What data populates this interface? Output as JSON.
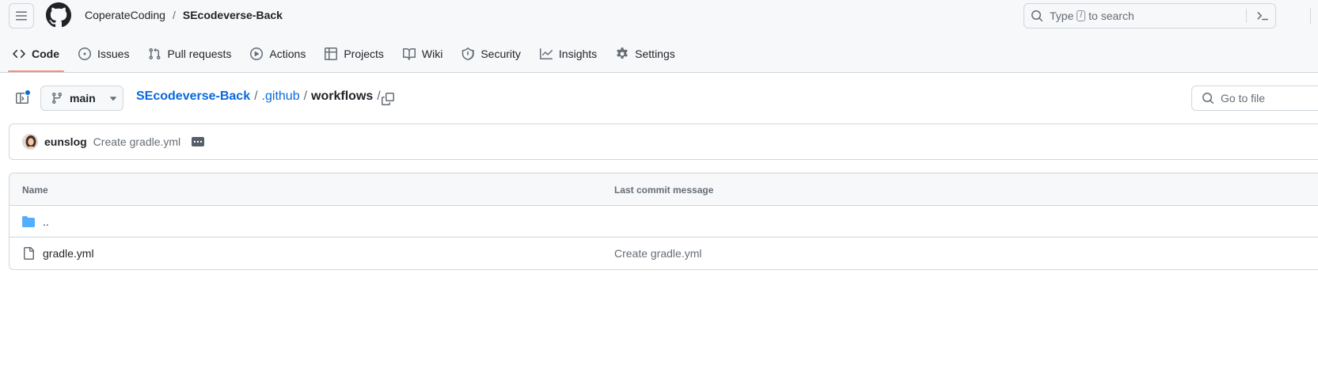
{
  "header": {
    "owner": "CoperateCoding",
    "separator": "/",
    "repo": "SEcodeverse-Back",
    "search": {
      "prefix": "Type",
      "shortcut": "/",
      "suffix": "to search"
    }
  },
  "nav": {
    "tabs": [
      {
        "label": "Code",
        "icon": "code-icon",
        "selected": true
      },
      {
        "label": "Issues",
        "icon": "issue-opened-icon"
      },
      {
        "label": "Pull requests",
        "icon": "git-pull-request-icon"
      },
      {
        "label": "Actions",
        "icon": "play-icon"
      },
      {
        "label": "Projects",
        "icon": "table-icon"
      },
      {
        "label": "Wiki",
        "icon": "book-icon"
      },
      {
        "label": "Security",
        "icon": "shield-icon"
      },
      {
        "label": "Insights",
        "icon": "graph-icon"
      },
      {
        "label": "Settings",
        "icon": "gear-icon"
      }
    ]
  },
  "path": {
    "branch": "main",
    "repo_link": "SEcodeverse-Back",
    "dir1": ".github",
    "current": "workflows",
    "sep": "/",
    "goto_placeholder": "Go to file"
  },
  "commit": {
    "author": "eunslog",
    "message": "Create gradle.yml"
  },
  "table": {
    "col_name": "Name",
    "col_message": "Last commit message",
    "rows": [
      {
        "name": "..",
        "type": "parent-dir",
        "message": ""
      },
      {
        "name": "gradle.yml",
        "type": "file",
        "message": "Create gradle.yml"
      }
    ]
  },
  "colors": {
    "link": "#0969da",
    "tab_underline": "#fd8c73",
    "folder": "#54aeff",
    "muted": "#656d76"
  }
}
